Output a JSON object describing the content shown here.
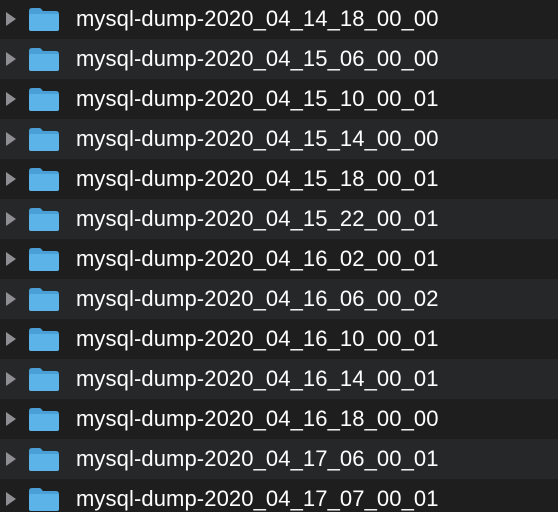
{
  "colors": {
    "background": "#1e1e1e",
    "stripe": "#262729",
    "folder": "#5bb3e8",
    "folder_tab": "#4a9fd6",
    "text": "#ffffff",
    "disclosure": "#8e8e93"
  },
  "rows": [
    {
      "name": "mysql-dump-2020_04_14_18_00_00",
      "icon": "folder-icon",
      "disclosure": "chevron-right-icon"
    },
    {
      "name": "mysql-dump-2020_04_15_06_00_00",
      "icon": "folder-icon",
      "disclosure": "chevron-right-icon"
    },
    {
      "name": "mysql-dump-2020_04_15_10_00_01",
      "icon": "folder-icon",
      "disclosure": "chevron-right-icon"
    },
    {
      "name": "mysql-dump-2020_04_15_14_00_00",
      "icon": "folder-icon",
      "disclosure": "chevron-right-icon"
    },
    {
      "name": "mysql-dump-2020_04_15_18_00_01",
      "icon": "folder-icon",
      "disclosure": "chevron-right-icon"
    },
    {
      "name": "mysql-dump-2020_04_15_22_00_01",
      "icon": "folder-icon",
      "disclosure": "chevron-right-icon"
    },
    {
      "name": "mysql-dump-2020_04_16_02_00_01",
      "icon": "folder-icon",
      "disclosure": "chevron-right-icon"
    },
    {
      "name": "mysql-dump-2020_04_16_06_00_02",
      "icon": "folder-icon",
      "disclosure": "chevron-right-icon"
    },
    {
      "name": "mysql-dump-2020_04_16_10_00_01",
      "icon": "folder-icon",
      "disclosure": "chevron-right-icon"
    },
    {
      "name": "mysql-dump-2020_04_16_14_00_01",
      "icon": "folder-icon",
      "disclosure": "chevron-right-icon"
    },
    {
      "name": "mysql-dump-2020_04_16_18_00_00",
      "icon": "folder-icon",
      "disclosure": "chevron-right-icon"
    },
    {
      "name": "mysql-dump-2020_04_17_06_00_01",
      "icon": "folder-icon",
      "disclosure": "chevron-right-icon"
    },
    {
      "name": "mysql-dump-2020_04_17_07_00_01",
      "icon": "folder-icon",
      "disclosure": "chevron-right-icon"
    }
  ]
}
